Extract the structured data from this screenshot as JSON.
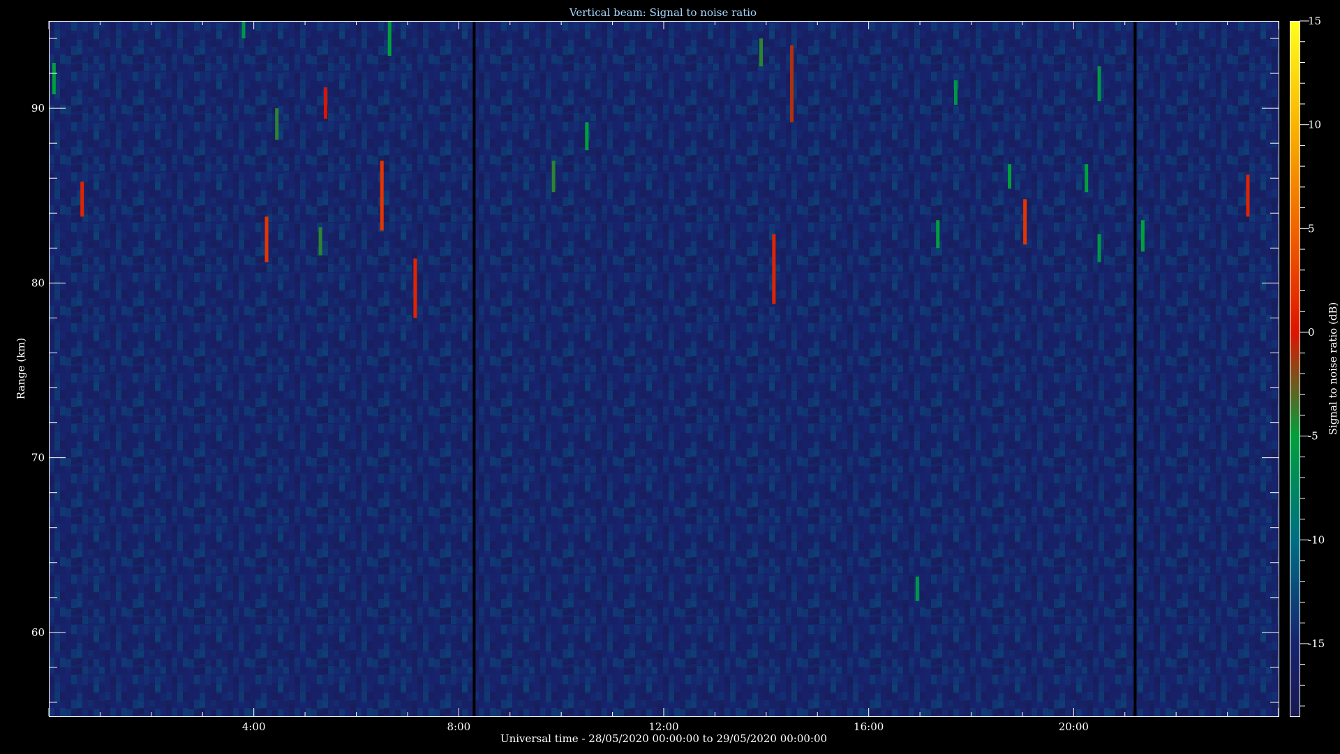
{
  "chart_data": {
    "type": "heatmap",
    "title": "Vertical beam: Signal to noise ratio",
    "xlabel": "Universal time - 28/05/2020 00:00:00 to 29/05/2020 00:00:00",
    "ylabel": "Range (km)",
    "colorbar_label": "Signal to noise ratio (dB)",
    "x_unit": "hours UT",
    "xlim": [
      0,
      24
    ],
    "ylim": [
      55.2,
      95
    ],
    "clim": [
      -18.5,
      15
    ],
    "x_tick_labels": [
      "4:00",
      "8:00",
      "12:00",
      "16:00",
      "20:00"
    ],
    "x_tick_values": [
      4,
      8,
      12,
      16,
      20
    ],
    "y_tick_labels": [
      "60",
      "70",
      "80",
      "90"
    ],
    "y_tick_values": [
      60,
      70,
      80,
      90
    ],
    "colorbar_tick_labels": [
      "-15",
      "-10",
      "-5",
      "0",
      "5",
      "10",
      "15"
    ],
    "colorbar_tick_values": [
      -15,
      -10,
      -5,
      0,
      5,
      10,
      15
    ],
    "background_level_db": -15,
    "data_gaps_hours": [
      8.3,
      21.2
    ],
    "echoes": [
      {
        "t": 0.1,
        "r0": 90.8,
        "r1": 92.6,
        "snr": -5
      },
      {
        "t": 0.65,
        "r0": 83.8,
        "r1": 85.8,
        "snr": 1
      },
      {
        "t": 3.8,
        "r0": 94.0,
        "r1": 95.0,
        "snr": -6
      },
      {
        "t": 4.25,
        "r0": 81.2,
        "r1": 83.8,
        "snr": 2
      },
      {
        "t": 4.45,
        "r0": 88.2,
        "r1": 90.0,
        "snr": -4
      },
      {
        "t": 5.3,
        "r0": 81.6,
        "r1": 83.2,
        "snr": -4
      },
      {
        "t": 5.4,
        "r0": 89.4,
        "r1": 91.2,
        "snr": 0
      },
      {
        "t": 6.5,
        "r0": 83.0,
        "r1": 87.0,
        "snr": 2
      },
      {
        "t": 6.65,
        "r0": 93.0,
        "r1": 95.0,
        "snr": -5
      },
      {
        "t": 7.15,
        "r0": 78.0,
        "r1": 81.4,
        "snr": 1
      },
      {
        "t": 9.85,
        "r0": 85.2,
        "r1": 87.0,
        "snr": -4
      },
      {
        "t": 10.5,
        "r0": 87.6,
        "r1": 89.2,
        "snr": -5
      },
      {
        "t": 13.9,
        "r0": 92.4,
        "r1": 94.0,
        "snr": -4
      },
      {
        "t": 14.15,
        "r0": 78.8,
        "r1": 82.8,
        "snr": 1
      },
      {
        "t": 14.5,
        "r0": 89.2,
        "r1": 93.6,
        "snr": -1
      },
      {
        "t": 16.95,
        "r0": 61.8,
        "r1": 63.2,
        "snr": -6
      },
      {
        "t": 17.35,
        "r0": 82.0,
        "r1": 83.6,
        "snr": -5
      },
      {
        "t": 17.7,
        "r0": 90.2,
        "r1": 91.6,
        "snr": -6
      },
      {
        "t": 18.75,
        "r0": 85.4,
        "r1": 86.8,
        "snr": -5
      },
      {
        "t": 19.05,
        "r0": 82.2,
        "r1": 84.8,
        "snr": 2
      },
      {
        "t": 20.25,
        "r0": 85.2,
        "r1": 86.8,
        "snr": -5
      },
      {
        "t": 20.5,
        "r0": 90.4,
        "r1": 92.4,
        "snr": -6
      },
      {
        "t": 20.5,
        "r0": 81.2,
        "r1": 82.8,
        "snr": -6
      },
      {
        "t": 21.35,
        "r0": 81.8,
        "r1": 83.6,
        "snr": -5
      },
      {
        "t": 23.4,
        "r0": 83.8,
        "r1": 86.2,
        "snr": 1
      }
    ]
  }
}
